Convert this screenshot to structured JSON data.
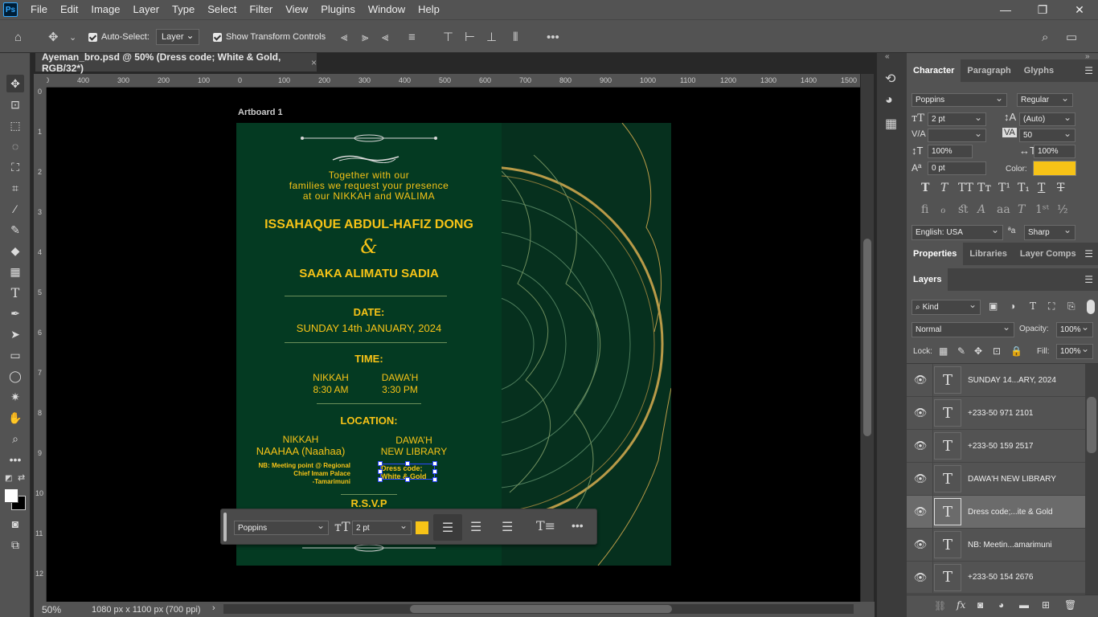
{
  "menubar": {
    "logo": "Ps",
    "items": [
      "File",
      "Edit",
      "Image",
      "Layer",
      "Type",
      "Select",
      "Filter",
      "View",
      "Plugins",
      "Window",
      "Help"
    ],
    "window_controls": [
      "—",
      "❐",
      "✕"
    ]
  },
  "options": {
    "auto_select_label": "Auto-Select:",
    "auto_select_value": "Layer",
    "show_transform_label": "Show Transform Controls"
  },
  "document": {
    "tab_title": "Ayeman_bro.psd @ 50% (Dress code; White & Gold, RGB/32*)",
    "close": "×",
    "artboard_label": "Artboard 1",
    "zoom": "50%",
    "doc_info": "1080 px x 1100 px (700 ppi)"
  },
  "ruler": {
    "h_ticks": [
      "0",
      "400",
      "300",
      "200",
      "100",
      "0",
      "100",
      "200",
      "300",
      "400",
      "500",
      "600",
      "700",
      "800",
      "900",
      "1000",
      "1100",
      "1200",
      "1300",
      "1400",
      "1500"
    ],
    "v_ticks": [
      "0",
      "1",
      "2",
      "3",
      "4",
      "5",
      "6",
      "7",
      "8",
      "9",
      "10",
      "11",
      "12"
    ]
  },
  "invite": {
    "intro_line1": "Together with our",
    "intro_line2": "families we request your presence",
    "intro_line3": "at our NIKKAH and WALIMA",
    "groom": "ISSAHAQUE ABDUL-HAFIZ DONG",
    "ampersand": "&",
    "bride": "SAAKA ALIMATU SADIA",
    "date_heading": "DATE:",
    "date_value": "SUNDAY 14th  JANUARY, 2024",
    "time_heading": "TIME:",
    "nikkah_label": "NIKKAH",
    "nikkah_time": "8:30 AM",
    "dawah_label": "DAWA’H",
    "dawah_time": "3:30 PM",
    "location_heading": "LOCATION:",
    "loc_nikkah_1": "NIKKAH",
    "loc_nikkah_2": "NAAHAA (Naahaa)",
    "loc_dawah_1": "DAWA’H",
    "loc_dawah_2": "NEW LIBRARY",
    "note_1": "NB: Meeting point @ Regional",
    "note_2": "Chief Imam Palace",
    "note_3": "-Tamarimuni",
    "dress_1": "Dress code;",
    "dress_2": "White & Gold",
    "rsvp": "R.S.V.P"
  },
  "floating_bar": {
    "font": "Poppins",
    "size": "2 pt",
    "color": "#f7c317"
  },
  "character": {
    "tabs": [
      "Character",
      "Paragraph",
      "Glyphs"
    ],
    "font_family": "Poppins",
    "font_style": "Regular",
    "size": "2 pt",
    "leading": "(Auto)",
    "kerning": "",
    "tracking": "50",
    "vscale": "100%",
    "hscale": "100%",
    "baseline": "0 pt",
    "color_label": "Color:",
    "color": "#f7c317",
    "language": "English: USA",
    "aa_label": "ªa",
    "antialias": "Sharp"
  },
  "properties_tabs": [
    "Properties",
    "Libraries",
    "Layer Comps"
  ],
  "layers_panel": {
    "title": "Layers",
    "filter": "Kind",
    "blend": "Normal",
    "opacity_label": "Opacity:",
    "opacity": "100%",
    "lock_label": "Lock:",
    "fill_label": "Fill:",
    "fill": "100%",
    "layers": [
      {
        "name": "SUNDAY 14...ARY, 2024"
      },
      {
        "name": "+233-50 971 2101"
      },
      {
        "name": "+233-50 159 2517"
      },
      {
        "name": "DAWA'H NEW LIBRARY"
      },
      {
        "name": "Dress code;...ite & Gold"
      },
      {
        "name": "NB: Meetin...amarimuni"
      },
      {
        "name": "+233-50 154 2676"
      }
    ]
  },
  "colors": {
    "accent": "#f7c317",
    "card": "#043a22"
  }
}
